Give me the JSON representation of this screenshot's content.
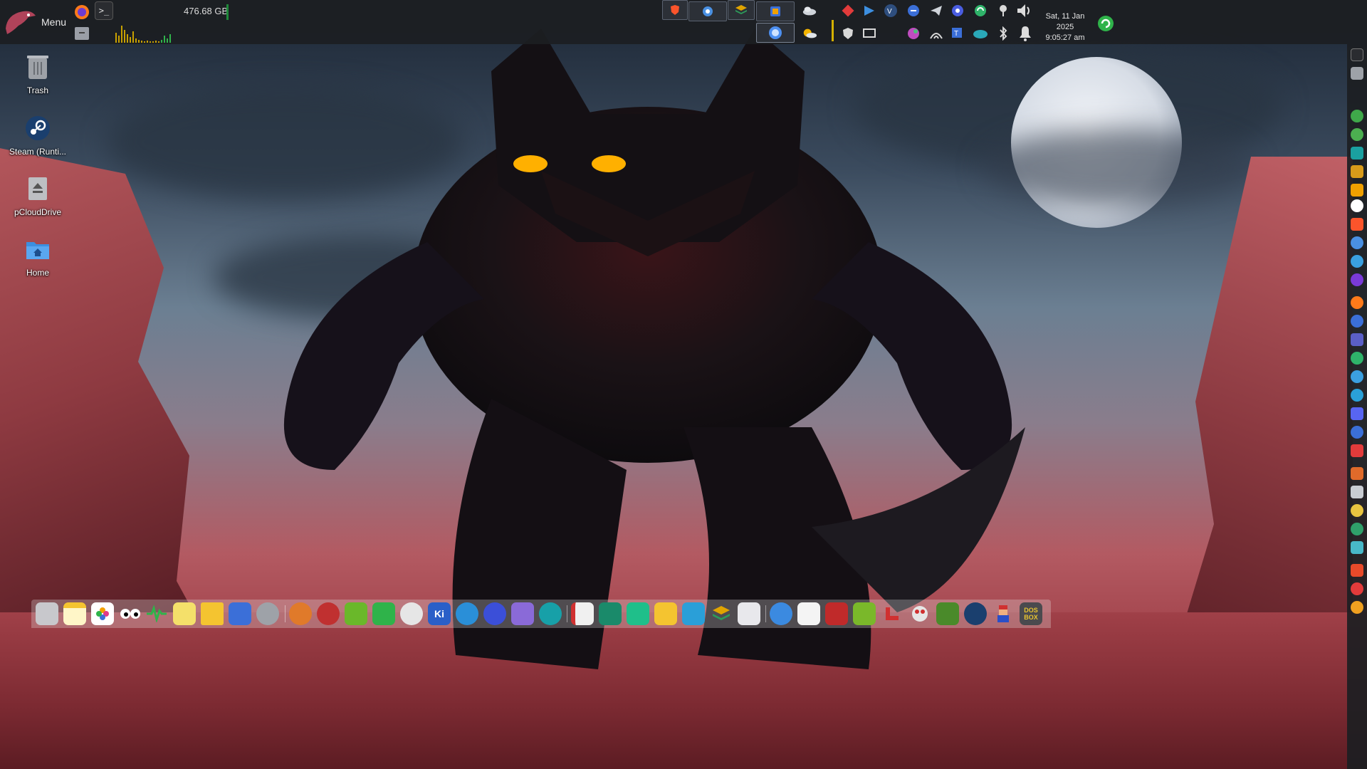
{
  "panel": {
    "menu_label": "Menu",
    "disk_usage": "476.68 GB",
    "clock_date": "Sat, 11 Jan 2025",
    "clock_time": "9:05:27 am"
  },
  "desktop_icons": [
    {
      "label": "Trash",
      "icon": "trash-icon"
    },
    {
      "label": "Steam (Runti...",
      "icon": "steam-icon"
    },
    {
      "label": "pCloudDrive",
      "icon": "drive-eject-icon"
    },
    {
      "label": "Home",
      "icon": "home-folder-icon"
    }
  ],
  "dock": {
    "kiwix_label": "Ki",
    "dosbox_label": "DOS BOX"
  },
  "colors": {
    "panel_bg": "#1c1e22",
    "accent_green": "#2fb34a",
    "graph_yellow": "#c8a000"
  }
}
